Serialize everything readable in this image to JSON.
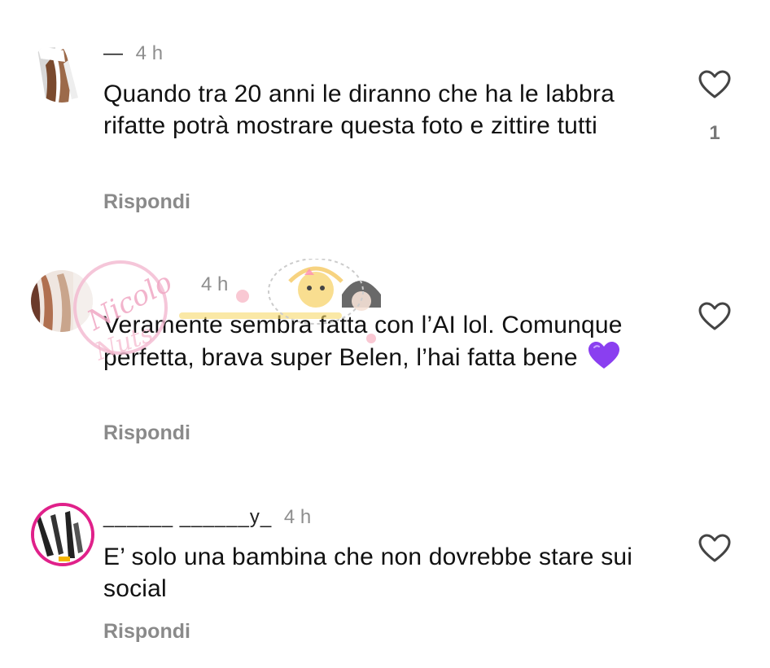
{
  "comments": [
    {
      "username": "—",
      "time": "4 h",
      "text": "Quando tra 20 anni le diranno che ha le labbra rifatte potrà mostrare questa foto e zittire tutti",
      "reply_label": "Rispondi",
      "likes": "1",
      "like_icon": "heart-outline-icon"
    },
    {
      "username": "",
      "time": "4 h",
      "text": "Veramente sembra fatta con l’AI lol. Comunque perfetta, brava super Belen, l’hai fatta bene",
      "emoji": "purple-heart",
      "reply_label": "Rispondi",
      "like_icon": "heart-outline-icon"
    },
    {
      "username": "______ ______y_",
      "time": "4 h",
      "text": "E’ solo una bambina che non dovrebbe stare sui social",
      "reply_label": "Rispondi",
      "like_icon": "heart-outline-icon"
    }
  ],
  "watermark": {
    "text": "Nicolo Nuts"
  },
  "colors": {
    "text": "#111111",
    "muted": "#8e8e8e",
    "reply": "#8a8a8a",
    "emoji_heart": "#8a3ff0"
  }
}
